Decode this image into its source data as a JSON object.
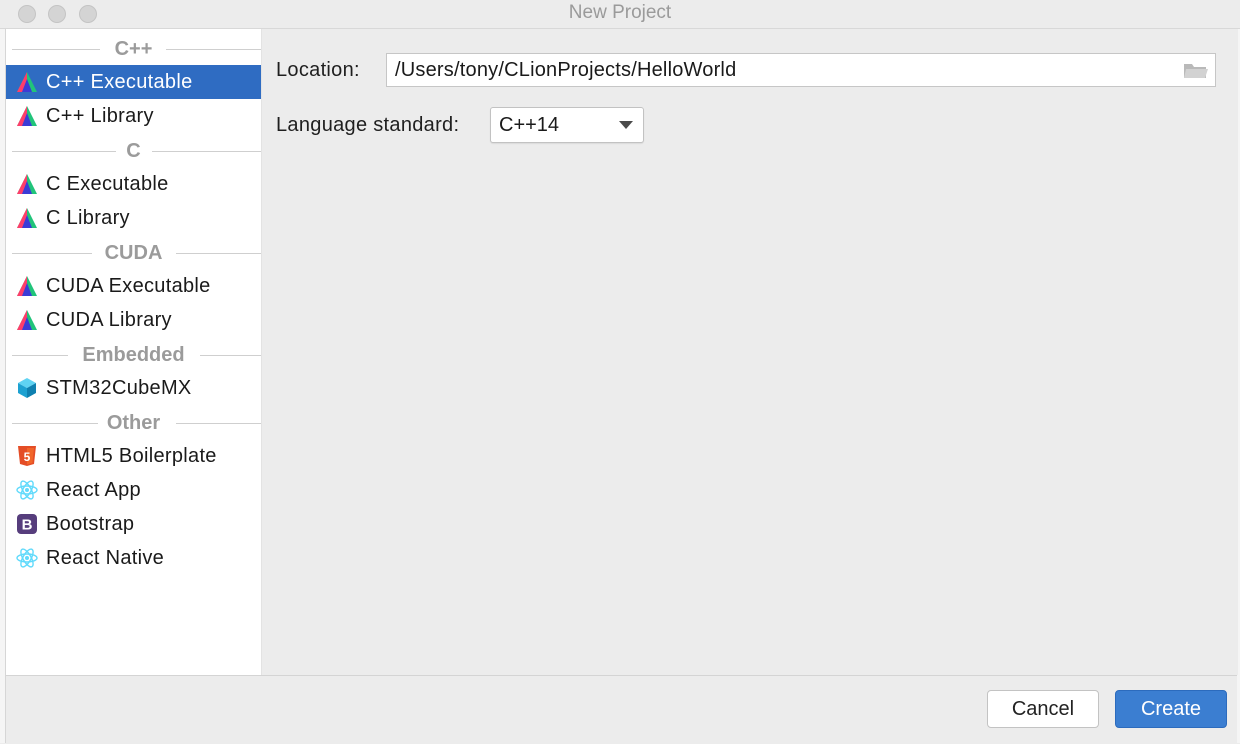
{
  "window": {
    "title": "New Project"
  },
  "sidebar": {
    "groups": [
      {
        "header": "C++",
        "items": [
          {
            "label": "C++ Executable",
            "icon": "clion-triangle-icon",
            "selected": true
          },
          {
            "label": "C++ Library",
            "icon": "clion-triangle-icon"
          }
        ]
      },
      {
        "header": "C",
        "items": [
          {
            "label": "C Executable",
            "icon": "clion-triangle-icon"
          },
          {
            "label": "C Library",
            "icon": "clion-triangle-icon"
          }
        ]
      },
      {
        "header": "CUDA",
        "items": [
          {
            "label": "CUDA Executable",
            "icon": "clion-triangle-icon"
          },
          {
            "label": "CUDA Library",
            "icon": "clion-triangle-icon"
          }
        ]
      },
      {
        "header": "Embedded",
        "items": [
          {
            "label": "STM32CubeMX",
            "icon": "cube-icon"
          }
        ]
      },
      {
        "header": "Other",
        "items": [
          {
            "label": "HTML5 Boilerplate",
            "icon": "html5-icon"
          },
          {
            "label": "React App",
            "icon": "react-icon"
          },
          {
            "label": "Bootstrap",
            "icon": "bootstrap-icon"
          },
          {
            "label": "React Native",
            "icon": "react-icon"
          }
        ]
      }
    ]
  },
  "form": {
    "location_label": "Location:",
    "location_value": "/Users/tony/CLionProjects/HelloWorld",
    "language_label": "Language standard:",
    "language_value": "C++14"
  },
  "footer": {
    "cancel_label": "Cancel",
    "create_label": "Create"
  },
  "colors": {
    "selection": "#2f6cc2",
    "primary_button": "#3b7ed1"
  }
}
